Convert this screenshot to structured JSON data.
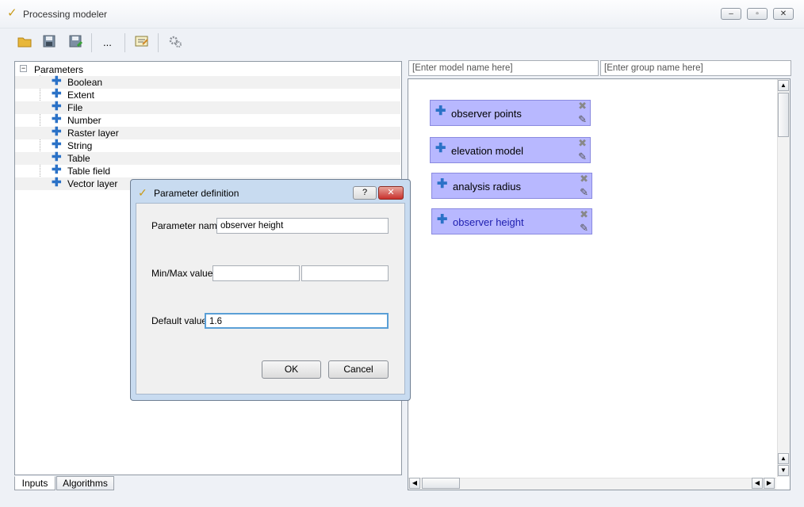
{
  "window": {
    "title": "Processing modeler",
    "min": "‒",
    "max": "▫",
    "close": "✕"
  },
  "toolbar": {
    "ellipsis": "..."
  },
  "tree": {
    "root": "Parameters",
    "items": [
      "Boolean",
      "Extent",
      "File",
      "Number",
      "Raster layer",
      "String",
      "Table",
      "Table field",
      "Vector layer"
    ]
  },
  "tabs": [
    "Inputs",
    "Algorithms"
  ],
  "model": {
    "name_placeholder": "[Enter model name here]",
    "group_placeholder": "[Enter group name here]"
  },
  "nodes": [
    "observer points",
    "elevation model",
    "analysis radius",
    "observer height"
  ],
  "dialog": {
    "title": "Parameter definition",
    "help": "?",
    "close": "✕",
    "param_name_label": "Parameter name",
    "param_name_value": "observer height",
    "minmax_label": "Min/Max values",
    "min_value": "",
    "max_value": "",
    "default_label": "Default value",
    "default_value": "1.6",
    "ok": "OK",
    "cancel": "Cancel"
  },
  "colors": {
    "node_fill": "#b8b8ff",
    "accent": "#2b72c7",
    "close_red": "#c9302c"
  }
}
